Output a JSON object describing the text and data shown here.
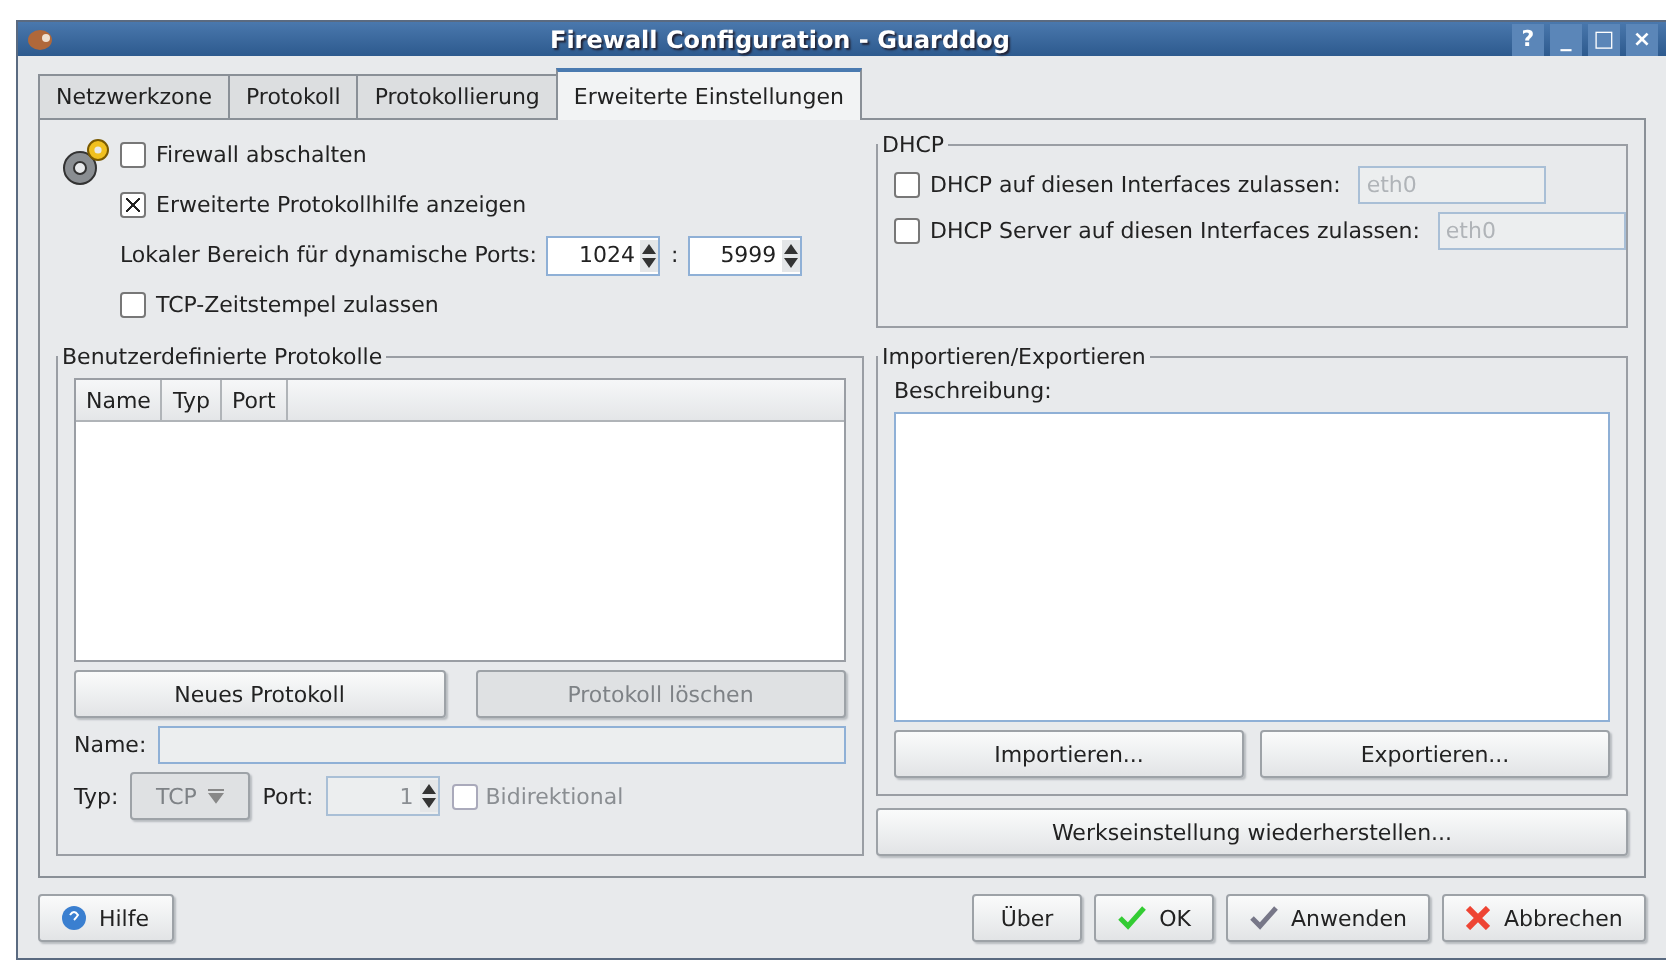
{
  "window": {
    "title": "Firewall Configuration - Guarddog",
    "controls": [
      "?",
      "_",
      "□",
      "×"
    ]
  },
  "tabs": [
    {
      "label": "Netzwerkzone",
      "selected": false
    },
    {
      "label": "Protokoll",
      "selected": false
    },
    {
      "label": "Protokollierung",
      "selected": false
    },
    {
      "label": "Erweiterte Einstellungen",
      "selected": true
    }
  ],
  "options": {
    "firewall_off": {
      "label": "Firewall abschalten",
      "checked": false
    },
    "protocol_help": {
      "label": "Erweiterte Protokollhilfe anzeigen",
      "checked": true
    },
    "port_range": {
      "label": "Lokaler Bereich für dynamische Ports:",
      "from": "1024",
      "separator": ":",
      "to": "5999"
    },
    "tcp_timestamps": {
      "label": "TCP-Zeitstempel zulassen",
      "checked": false
    }
  },
  "dhcp": {
    "title": "DHCP",
    "rows": [
      {
        "label": "DHCP auf diesen Interfaces zulassen:",
        "checked": false,
        "value": "eth0",
        "disabled": true
      },
      {
        "label": "DHCP Server auf diesen Interfaces zulassen:",
        "checked": false,
        "value": "eth0",
        "disabled": true
      }
    ]
  },
  "custom_protocols": {
    "title": "Benutzerdefinierte Protokolle",
    "columns": [
      "Name",
      "Typ",
      "Port"
    ],
    "buttons": [
      {
        "label": "Neues Protokoll",
        "disabled": false
      },
      {
        "label": "Protokoll löschen",
        "disabled": true
      }
    ],
    "name": {
      "label": "Name:",
      "disabled": false
    },
    "type": {
      "label": "Typ:",
      "value": "TCP",
      "disabled": true
    },
    "port": {
      "label": "Port:",
      "value": "1",
      "disabled": true
    },
    "bidirectional": {
      "label": "Bidirektional",
      "checked": false,
      "disabled": true
    }
  },
  "import_export": {
    "title": "Importieren/Exportieren",
    "description_label": "Beschreibung:",
    "buttons": [
      {
        "label": "Importieren..."
      },
      {
        "label": "Exportieren..."
      }
    ]
  },
  "reset_button": "Werkseinstellung wiederherstellen...",
  "footer": {
    "help": "Hilfe",
    "buttons": [
      {
        "label": "Über",
        "kind": "plain"
      },
      {
        "label": "OK",
        "kind": "ok"
      },
      {
        "label": "Anwenden",
        "kind": "apply"
      },
      {
        "label": "Abbrechen",
        "kind": "cancel"
      }
    ]
  }
}
